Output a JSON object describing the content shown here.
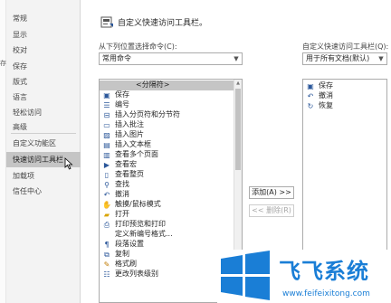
{
  "left_strip": {
    "hint": "存"
  },
  "nav": {
    "items": [
      "常规",
      "显示",
      "校对",
      "保存",
      "版式",
      "语言",
      "轻松访问",
      "高级",
      "自定义功能区",
      "快速访问工具栏",
      "加载项",
      "信任中心"
    ],
    "selected_index": 9
  },
  "header": {
    "title": "自定义快速访问工具栏。"
  },
  "left_panel": {
    "label": "从下列位置选择命令(C):",
    "dropdown_value": "常用命令",
    "commands": [
      {
        "label": "<分隔符>",
        "icon": "separator-icon"
      },
      {
        "label": "保存",
        "icon": "save-icon"
      },
      {
        "label": "编号",
        "icon": "numbering-icon",
        "submenu": true
      },
      {
        "label": "插入分页符和分节符",
        "icon": "page-break-icon",
        "submenu": true
      },
      {
        "label": "插入批注",
        "icon": "comment-icon"
      },
      {
        "label": "插入图片",
        "icon": "picture-icon"
      },
      {
        "label": "插入文本框",
        "icon": "textbox-icon"
      },
      {
        "label": "查看多个页面",
        "icon": "multipage-icon"
      },
      {
        "label": "查看宏",
        "icon": "macro-icon"
      },
      {
        "label": "查看整页",
        "icon": "fullpage-icon"
      },
      {
        "label": "查找",
        "icon": "find-icon"
      },
      {
        "label": "撤消",
        "icon": "undo-icon",
        "submenu": true
      },
      {
        "label": "触摸/鼠标模式",
        "icon": "touch-icon",
        "submenu": true
      },
      {
        "label": "打开",
        "icon": "open-icon"
      },
      {
        "label": "打印预览和打印",
        "icon": "print-preview-icon"
      },
      {
        "label": "定义新编号格式...",
        "icon": "blank-icon"
      },
      {
        "label": "段落设置",
        "icon": "paragraph-icon"
      },
      {
        "label": "复制",
        "icon": "copy-icon"
      },
      {
        "label": "格式刷",
        "icon": "format-painter-icon"
      },
      {
        "label": "更改列表级别",
        "icon": "list-level-icon"
      }
    ]
  },
  "buttons": {
    "add": "添加(A) >>",
    "remove": "<< 删除(R)"
  },
  "right_panel": {
    "label": "自定义快速访问工具栏(Q):",
    "dropdown_value": "用于所有文档(默认)",
    "commands": [
      {
        "label": "保存",
        "icon": "save-icon"
      },
      {
        "label": "撤消",
        "icon": "undo-icon"
      },
      {
        "label": "恢复",
        "icon": "redo-icon"
      }
    ]
  },
  "watermark": {
    "text": "飞飞系统",
    "url": "www.feifeixitong.com"
  },
  "colors": {
    "accent": "#2b579a",
    "selected": "#c5c5c5",
    "watermark": "#1a7ed6"
  }
}
